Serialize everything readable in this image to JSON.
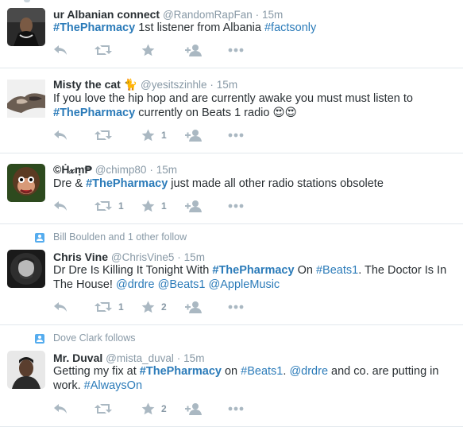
{
  "tweets": [
    {
      "fullname": "ur Albanian connect",
      "username": "@RandomRapFan",
      "sep": "·",
      "time": "15m",
      "context": "",
      "text_parts": [
        {
          "t": "#ThePharmacy",
          "hash": true,
          "bold": true
        },
        {
          "t": " 1st listener from Albania "
        },
        {
          "t": "#factsonly",
          "hash": true
        }
      ],
      "retweets": "",
      "likes": ""
    },
    {
      "fullname": "Misty the cat 🐈",
      "username": "@yesitszinhle",
      "sep": "·",
      "time": "15m",
      "context": "",
      "text_parts": [
        {
          "t": "If you love the hip hop and are currently awake you must must listen to "
        },
        {
          "t": "#ThePharmacy",
          "hash": true,
          "bold": true
        },
        {
          "t": " currently on Beats 1 radio 😍😍"
        }
      ],
      "retweets": "",
      "likes": "1"
    },
    {
      "fullname": "©Ḣ𝓍ṃ₱",
      "username": "@chimp80",
      "sep": "·",
      "time": "15m",
      "context": "",
      "text_parts": [
        {
          "t": "Dre & "
        },
        {
          "t": "#ThePharmacy",
          "hash": true,
          "bold": true
        },
        {
          "t": " just made all other radio stations obsolete"
        }
      ],
      "retweets": "1",
      "likes": "1"
    },
    {
      "fullname": "Chris Vine",
      "username": "@ChrisVine5",
      "sep": "·",
      "time": "15m",
      "context": "Bill Boulden and 1 other follow",
      "text_parts": [
        {
          "t": "Dr Dre Is Killing It Tonight With "
        },
        {
          "t": "#ThePharmacy",
          "hash": true,
          "bold": true
        },
        {
          "t": " On "
        },
        {
          "t": "#Beats1",
          "hash": true
        },
        {
          "t": ". The Doctor Is In The House! "
        },
        {
          "t": "@drdre",
          "hash": true
        },
        {
          "t": " "
        },
        {
          "t": "@Beats1",
          "hash": true
        },
        {
          "t": " "
        },
        {
          "t": "@AppleMusic",
          "hash": true
        }
      ],
      "retweets": "1",
      "likes": "2"
    },
    {
      "fullname": "Mr. Duval",
      "username": "@mista_duval",
      "sep": "·",
      "time": "15m",
      "context": "Dove Clark follows",
      "text_parts": [
        {
          "t": "Getting my fix at "
        },
        {
          "t": "#ThePharmacy",
          "hash": true,
          "bold": true
        },
        {
          "t": " on "
        },
        {
          "t": "#Beats1",
          "hash": true
        },
        {
          "t": ". "
        },
        {
          "t": "@drdre",
          "hash": true
        },
        {
          "t": " and co. are putting in work. "
        },
        {
          "t": "#AlwaysOn",
          "hash": true
        }
      ],
      "retweets": "",
      "likes": "2"
    }
  ],
  "icons": {
    "reply": "reply-icon",
    "retweet": "retweet-icon",
    "like": "star-icon",
    "follow": "follow-icon",
    "more": "more-icon",
    "context": "follow-context-icon"
  },
  "colors": {
    "link": "#2b7bb9",
    "muted": "#8899a6",
    "text": "#292f33",
    "icon": "#aab8c2",
    "divider": "#e1e8ed",
    "context_badge": "#55acee"
  }
}
